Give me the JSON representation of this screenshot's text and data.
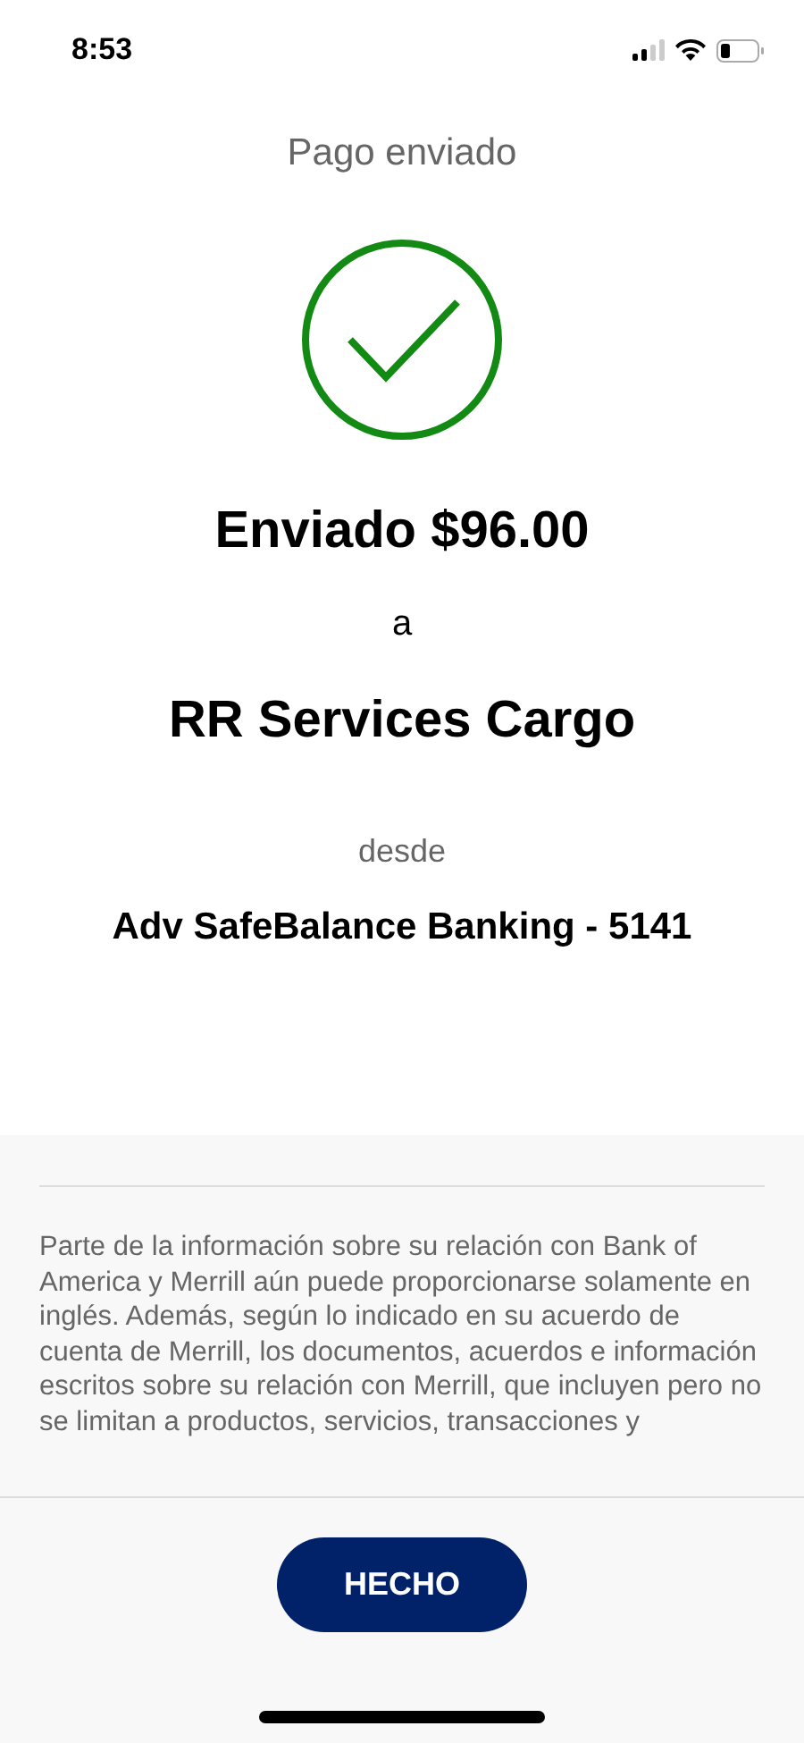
{
  "status_bar": {
    "time": "8:53"
  },
  "title": "Pago enviado",
  "confirmation": {
    "success": true,
    "amount_line": "Enviado $96.00",
    "to_word": "a",
    "payee": "RR Services Cargo",
    "from_word": "desde",
    "account": "Adv SafeBalance Banking - 5141"
  },
  "disclaimer": "Parte de la información sobre su relación con Bank of America y Merrill aún puede proporcionarse solamente en inglés. Además, según lo indicado en su acuerdo de cuenta de Merrill, los documentos, acuerdos e información escritos sobre su relación con Merrill, que incluyen pero no se limitan a productos, servicios, transacciones y",
  "buttons": [
    {
      "label": "HECHO"
    }
  ]
}
